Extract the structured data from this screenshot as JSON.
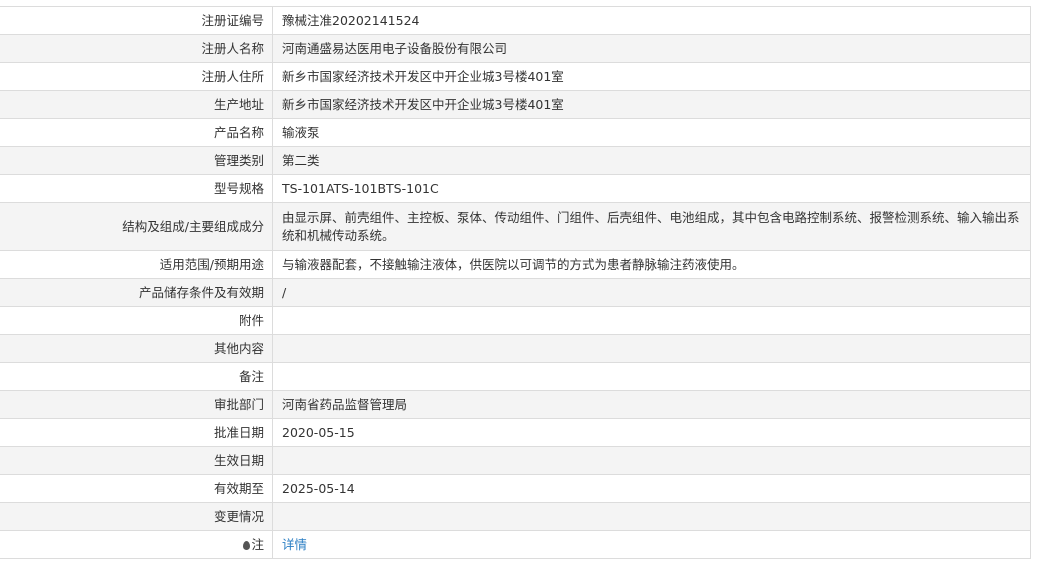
{
  "rows": [
    {
      "label": "注册证编号",
      "value": "豫械注准20202141524"
    },
    {
      "label": "注册人名称",
      "value": "河南通盛易达医用电子设备股份有限公司"
    },
    {
      "label": "注册人住所",
      "value": "新乡市国家经济技术开发区中开企业城3号楼401室"
    },
    {
      "label": "生产地址",
      "value": "新乡市国家经济技术开发区中开企业城3号楼401室"
    },
    {
      "label": "产品名称",
      "value": "输液泵"
    },
    {
      "label": "管理类别",
      "value": "第二类"
    },
    {
      "label": "型号规格",
      "value": "TS-101ATS-101BTS-101C"
    },
    {
      "label": "结构及组成/主要组成成分",
      "value": "由显示屏、前壳组件、主控板、泵体、传动组件、门组件、后壳组件、电池组成，其中包含电路控制系统、报警检测系统、输入输出系统和机械传动系统。"
    },
    {
      "label": "适用范围/预期用途",
      "value": "与输液器配套，不接触输注液体，供医院以可调节的方式为患者静脉输注药液使用。"
    },
    {
      "label": "产品储存条件及有效期",
      "value": "/"
    },
    {
      "label": "附件",
      "value": ""
    },
    {
      "label": "其他内容",
      "value": ""
    },
    {
      "label": "备注",
      "value": ""
    },
    {
      "label": "审批部门",
      "value": "河南省药品监督管理局"
    },
    {
      "label": "批准日期",
      "value": "2020-05-15"
    },
    {
      "label": "生效日期",
      "value": ""
    },
    {
      "label": "有效期至",
      "value": "2025-05-14"
    },
    {
      "label": "变更情况",
      "value": ""
    }
  ],
  "note": {
    "label": "注",
    "icon": "pin-icon",
    "link": "详情"
  }
}
